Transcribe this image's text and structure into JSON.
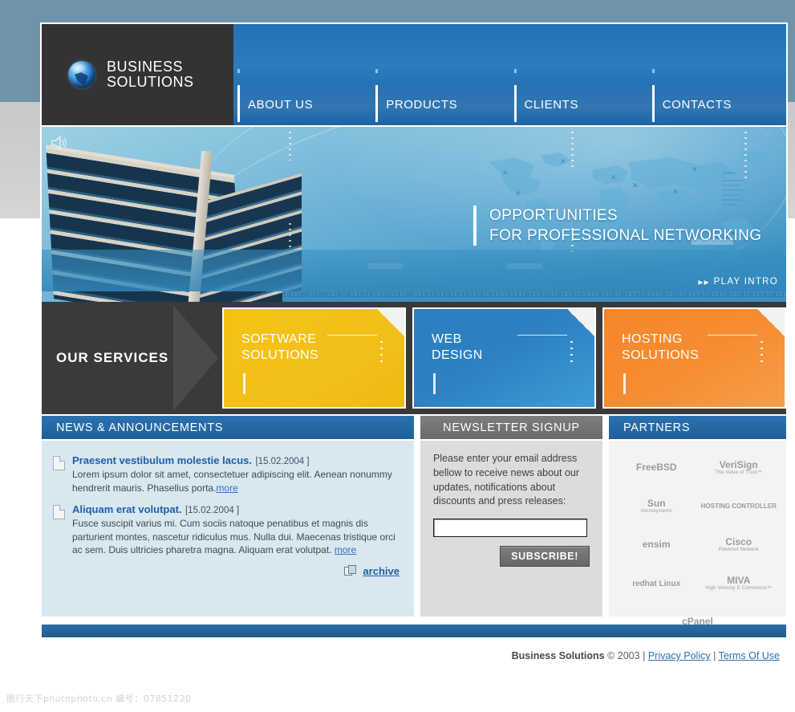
{
  "brand": {
    "line1": "BUSINESS",
    "line2": "SOLUTIONS",
    "logo_icon": "globe-icon"
  },
  "nav": {
    "items": [
      {
        "label": "ABOUT US"
      },
      {
        "label": "PRODUCTS"
      },
      {
        "label": "CLIENTS"
      },
      {
        "label": "CONTACTS"
      }
    ]
  },
  "hero": {
    "sound_icon": "speaker-icon",
    "headline_line1": "OPPORTUNITIES",
    "headline_line2": "FOR PROFESSIONAL NETWORKING",
    "play_intro": "PLAY INTRO",
    "play_icon": "fast-forward-icon",
    "binary_strip": "1011001000110101101011101110011010110101011010111011101101010110101110110101101011101101011010111011010110101110110101101011101101011010111011010"
  },
  "services": {
    "label": "OUR SERVICES",
    "cards": [
      {
        "title_line1": "SOFTWARE",
        "title_line2": "SOLUTIONS",
        "color": "#f5c213"
      },
      {
        "title_line1": "WEB",
        "title_line2": "DESIGN",
        "color": "#2b7fc0"
      },
      {
        "title_line1": "HOSTING",
        "title_line2": "SOLUTIONS",
        "color": "#f5862a"
      }
    ]
  },
  "news": {
    "heading": "NEWS & ANNOUNCEMENTS",
    "items": [
      {
        "title": "Praesent vestibulum molestie lacus.",
        "date": "[15.02.2004 ]",
        "body": "Lorem ipsum dolor sit amet, consectetuer adipiscing elit. Aenean nonummy hendrerit mauris. Phasellus porta.",
        "more": "more",
        "icon": "document-icon"
      },
      {
        "title": "Aliquam erat volutpat.",
        "date": "[15.02.2004 ]",
        "body": "Fusce suscipit varius mi. Cum sociis natoque penatibus et magnis dis parturient montes, nascetur ridiculus mus. Nulla dui. Maecenas tristique orci ac sem. Duis ultricies pharetra magna. Aliquam erat volutpat.",
        "more": "more",
        "icon": "document-icon"
      }
    ],
    "archive_label": "archive",
    "archive_icon": "archive-folder-icon"
  },
  "newsletter": {
    "heading": "NEWSLETTER SIGNUP",
    "description": "Please enter your email address bellow to receive news about our updates, notifications about discounts and press releases:",
    "email_value": "",
    "email_placeholder": "",
    "button_label": "SUBSCRIBE!"
  },
  "partners": {
    "heading": "PARTNERS",
    "logos": [
      {
        "name": "FreeBSD",
        "tagline": ""
      },
      {
        "name": "VeriSign",
        "tagline": "The Value of Trust™"
      },
      {
        "name": "Sun",
        "tagline": "microsystems"
      },
      {
        "name": "HOSTING CONTROLLER",
        "tagline": ""
      },
      {
        "name": "ensim",
        "tagline": ""
      },
      {
        "name": "Cisco",
        "tagline": "Powered Network"
      },
      {
        "name": "redhat Linux",
        "tagline": ""
      },
      {
        "name": "MIVA",
        "tagline": "High Velocity E-Commerce™"
      },
      {
        "name": "cPanel",
        "tagline": ""
      }
    ]
  },
  "footer": {
    "company": "Business Solutions",
    "copyright": "© 2003",
    "sep": "|",
    "privacy_label": "Privacy Policy",
    "terms_label": "Terms Of Use"
  },
  "watermark": {
    "text": "图行天下photophoto.cn  编号：07851220"
  }
}
